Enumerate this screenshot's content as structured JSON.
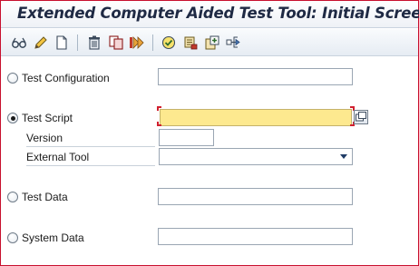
{
  "window": {
    "title": "Extended Computer Aided Test Tool: Initial Screen"
  },
  "toolbar": {
    "buttons": [
      {
        "name": "other-object-button",
        "icon": "glasses-icon"
      },
      {
        "name": "change-button",
        "icon": "pencil-icon"
      },
      {
        "name": "create-button",
        "icon": "blank-page-icon"
      },
      {
        "name": "delete-button",
        "icon": "trash-icon"
      },
      {
        "name": "copy-button",
        "icon": "copy-icon"
      },
      {
        "name": "execute-button",
        "icon": "execute-arrows-icon"
      },
      {
        "name": "check-button",
        "icon": "check-circle-icon"
      },
      {
        "name": "where-used-button",
        "icon": "document-stamp-icon"
      },
      {
        "name": "generate-button",
        "icon": "add-object-icon"
      },
      {
        "name": "navigate-button",
        "icon": "hierarchy-arrows-icon"
      }
    ]
  },
  "form": {
    "test_configuration": {
      "label": "Test Configuration",
      "value": "",
      "selected": false
    },
    "test_script": {
      "label": "Test Script",
      "value": "",
      "selected": true,
      "required": true
    },
    "version": {
      "label": "Version",
      "value": ""
    },
    "external_tool": {
      "label": "External Tool",
      "value": ""
    },
    "test_data": {
      "label": "Test Data",
      "value": "",
      "selected": false
    },
    "system_data": {
      "label": "System Data",
      "value": "",
      "selected": false
    }
  },
  "colors": {
    "frame_border": "#c8102e",
    "required_field": "#fde98f",
    "required_marker": "#d1202f",
    "title_text": "#1f2a44"
  }
}
